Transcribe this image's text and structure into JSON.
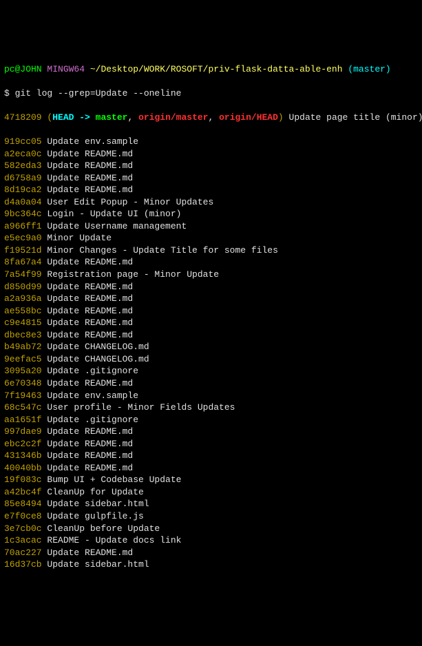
{
  "prompt": {
    "user": "pc@JOHN",
    "env": "MINGW64",
    "path": "~/Desktop/WORK/ROSOFT/priv-flask-datta-able-enh",
    "branch": "(master)"
  },
  "command": "$ git log --grep=Update --oneline",
  "head_commit": {
    "hash": "4718209",
    "open_paren": "(",
    "head_label": "HEAD ->",
    "master_label": " master",
    "sep1": ", ",
    "origin_master": "origin/master",
    "sep2": ", ",
    "origin_head": "origin/HEAD",
    "close_paren": ")",
    "msg": " Update page title (minor)"
  },
  "commits": [
    {
      "hash": "919cc05",
      "msg": "Update env.sample"
    },
    {
      "hash": "a2eca0c",
      "msg": "Update README.md"
    },
    {
      "hash": "582eda3",
      "msg": "Update README.md"
    },
    {
      "hash": "d6758a9",
      "msg": "Update README.md"
    },
    {
      "hash": "8d19ca2",
      "msg": "Update README.md"
    },
    {
      "hash": "d4a0a04",
      "msg": "User Edit Popup - Minor Updates"
    },
    {
      "hash": "9bc364c",
      "msg": "Login - Update UI (minor)"
    },
    {
      "hash": "a966ff1",
      "msg": "Update Username management"
    },
    {
      "hash": "e5ec9a0",
      "msg": "Minor Update"
    },
    {
      "hash": "f19521d",
      "msg": "Minor Changes - Update Title for some files"
    },
    {
      "hash": "8fa67a4",
      "msg": "Update README.md"
    },
    {
      "hash": "7a54f99",
      "msg": "Registration page - Minor Update"
    },
    {
      "hash": "d850d99",
      "msg": "Update README.md"
    },
    {
      "hash": "a2a936a",
      "msg": "Update README.md"
    },
    {
      "hash": "ae558bc",
      "msg": "Update README.md"
    },
    {
      "hash": "c9e4815",
      "msg": "Update README.md"
    },
    {
      "hash": "dbec8e3",
      "msg": "Update README.md"
    },
    {
      "hash": "b49ab72",
      "msg": "Update CHANGELOG.md"
    },
    {
      "hash": "9eefac5",
      "msg": "Update CHANGELOG.md"
    },
    {
      "hash": "3095a20",
      "msg": "Update .gitignore"
    },
    {
      "hash": "6e70348",
      "msg": "Update README.md"
    },
    {
      "hash": "7f19463",
      "msg": "Update env.sample"
    },
    {
      "hash": "68c547c",
      "msg": "User profile - Minor Fields Updates"
    },
    {
      "hash": "aa1651f",
      "msg": "Update .gitignore"
    },
    {
      "hash": "997dae9",
      "msg": "Update README.md"
    },
    {
      "hash": "ebc2c2f",
      "msg": "Update README.md"
    },
    {
      "hash": "431346b",
      "msg": "Update README.md"
    },
    {
      "hash": "40040bb",
      "msg": "Update README.md"
    },
    {
      "hash": "19f083c",
      "msg": "Bump UI + Codebase Update"
    },
    {
      "hash": "a42bc4f",
      "msg": "CleanUp for Update"
    },
    {
      "hash": "85e8494",
      "msg": "Update sidebar.html"
    },
    {
      "hash": "e7f0ce8",
      "msg": "Update gulpfile.js"
    },
    {
      "hash": "3e7cb0c",
      "msg": "CleanUp before Update"
    },
    {
      "hash": "1c3acac",
      "msg": "README - Update docs link"
    },
    {
      "hash": "70ac227",
      "msg": "Update README.md"
    },
    {
      "hash": "16d37cb",
      "msg": "Update sidebar.html"
    }
  ]
}
